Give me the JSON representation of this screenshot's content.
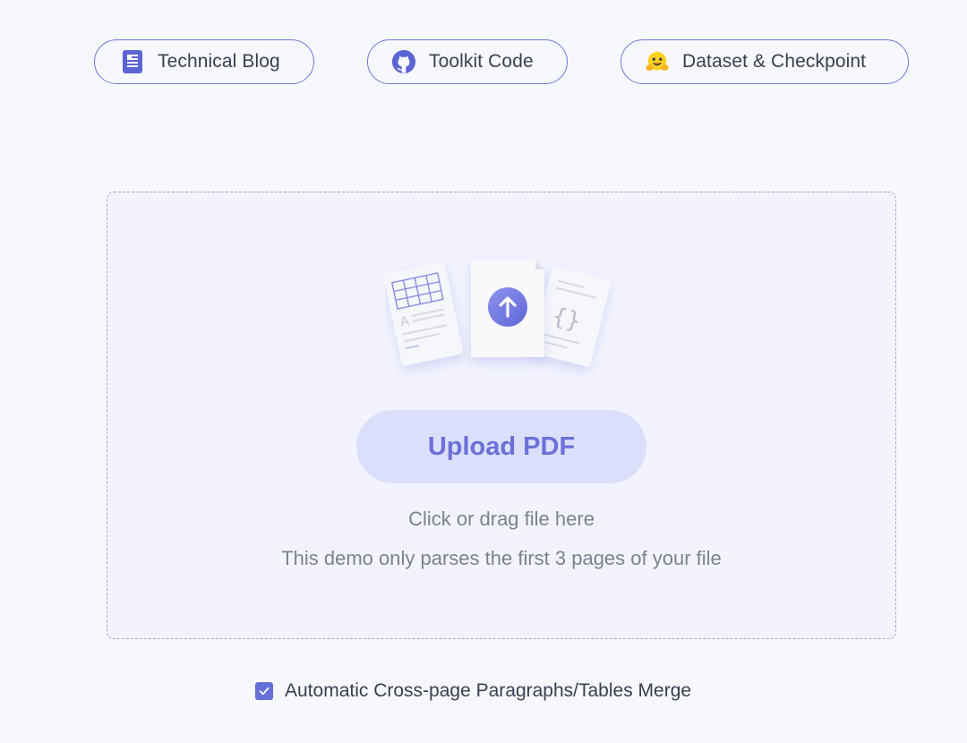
{
  "links": {
    "blog": {
      "label": "Technical Blog",
      "icon": "document-icon"
    },
    "code": {
      "label": "Toolkit Code",
      "icon": "github-icon"
    },
    "dataset": {
      "label": "Dataset & Checkpoint",
      "icon": "hugging-face-icon"
    }
  },
  "upload": {
    "button_label": "Upload PDF",
    "hint_primary": "Click or drag file here",
    "hint_secondary": "This demo only parses the first 3 pages of your file",
    "illustration_icons": [
      "table-document-icon",
      "upload-arrow-icon",
      "code-document-icon"
    ]
  },
  "options": {
    "merge_label": "Automatic Cross-page Paragraphs/Tables Merge",
    "merge_checked": true
  },
  "colors": {
    "accent": "#6670d8",
    "background": "#f7f8fd",
    "dropzone": "#f2f3fe",
    "button_bg": "#dcdffb"
  }
}
